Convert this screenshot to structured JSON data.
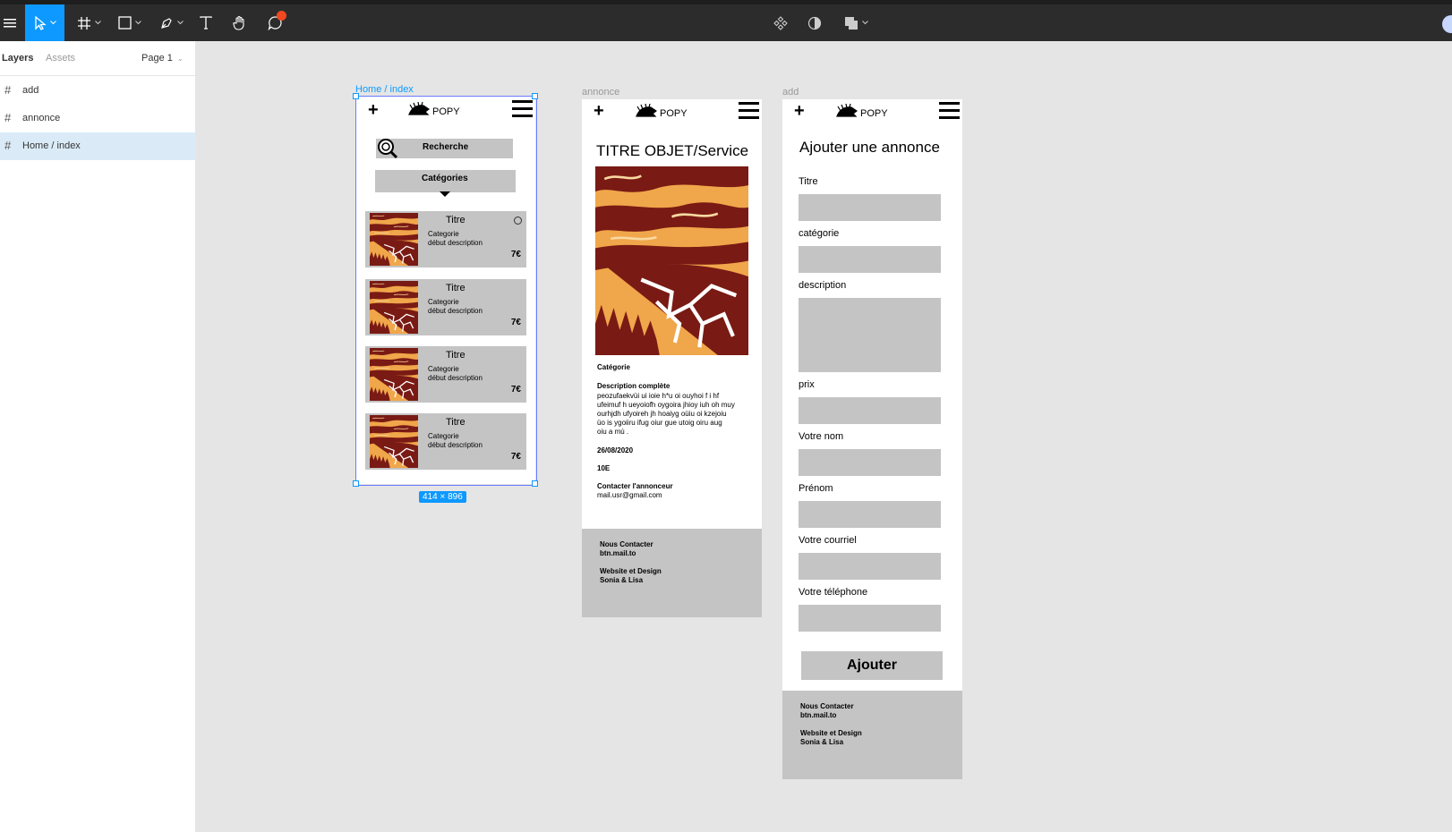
{
  "toolbar": {
    "tools": [
      "menu-icon",
      "move-icon",
      "frame-icon",
      "rectangle-icon",
      "pen-icon",
      "text-icon",
      "hand-icon",
      "comment-icon"
    ],
    "center_tools": [
      "components-icon",
      "mask-icon",
      "boolean-icon"
    ],
    "accent": "#0d99ff",
    "notification_color": "#f24822"
  },
  "left_panel": {
    "tabs": [
      "Layers",
      "Assets"
    ],
    "page": "Page 1",
    "layers": [
      "add",
      "annonce",
      "Home / index"
    ],
    "selected_layer": "Home / index"
  },
  "frames": {
    "home": {
      "label": "Home / index",
      "size_badge": "414 × 896",
      "header": {
        "logo": "POPY"
      },
      "search": {
        "label": "Recherche"
      },
      "categories": {
        "label": "Catégories"
      },
      "cards": [
        {
          "title": "Titre",
          "category": "Categorie",
          "description": "début description",
          "price": "7€"
        },
        {
          "title": "Titre",
          "category": "Categorie",
          "description": "début description",
          "price": "7€"
        },
        {
          "title": "Titre",
          "category": "Categorie",
          "description": "début description",
          "price": "7€"
        },
        {
          "title": "Titre",
          "category": "Categorie",
          "description": "début description",
          "price": "7€"
        }
      ]
    },
    "annonce": {
      "label": "annonce",
      "header": {
        "logo": "POPY"
      },
      "title": "TITRE OBJET/Service",
      "category": "Catégorie",
      "description_title": "Description complète",
      "description_lines": [
        "peozufaekvüi ui  ioie h*u oi ouyhoi f i hf",
        "ufeimuf h ueyoiofh oygoira jhioy iuh oh muy",
        "ourhjdh ufyoireh jh hoaiyg oüiu oi   kzejoiu",
        "üo is ygoiiru ifug oiur gue utoig oiru aug",
        "oiu a mù ."
      ],
      "date": "26/08/2020",
      "price": "10E",
      "contact_title": "Contacter l'annonceur",
      "contact_email": "mail.usr@gmail.com",
      "footer": {
        "contact_label": "Nous Contacter",
        "contact_link": "btn.mail.to",
        "credits_label": "Website et Design",
        "credits_names": "Sonia & Lisa"
      }
    },
    "add": {
      "label": "add",
      "header": {
        "logo": "POPY"
      },
      "title": "Ajouter une annonce",
      "fields": [
        "Titre",
        "catégorie",
        "description",
        "prix",
        "Votre nom",
        "Prénom",
        "Votre courriel",
        "Votre téléphone"
      ],
      "submit": "Ajouter",
      "footer": {
        "contact_label": "Nous Contacter",
        "contact_link": "btn.mail.to",
        "credits_label": "Website et Design",
        "credits_names": "Sonia & Lisa"
      }
    }
  }
}
